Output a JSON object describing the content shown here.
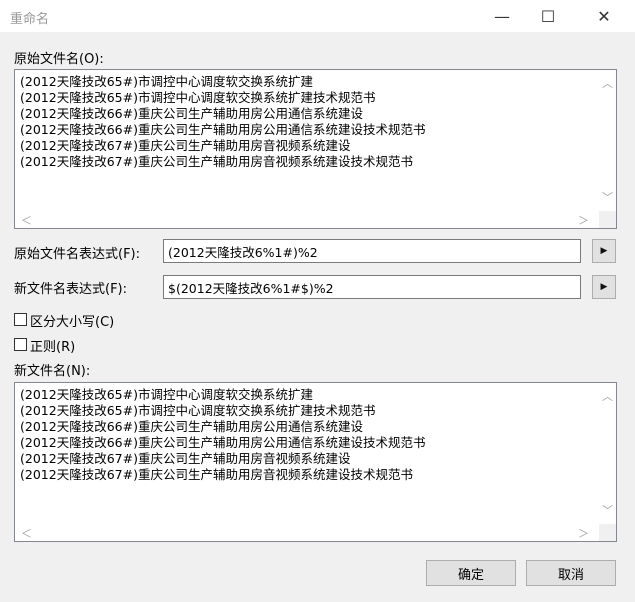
{
  "window": {
    "title": "重命名",
    "minimize_glyph": "—",
    "maximize_glyph": "☐",
    "close_glyph": "✕"
  },
  "original_names": {
    "label": "原始文件名(O):",
    "items": [
      "(2012天隆技改65#)市调控中心调度软交换系统扩建",
      "(2012天隆技改65#)市调控中心调度软交换系统扩建技术规范书",
      "(2012天隆技改66#)重庆公司生产辅助用房公用通信系统建设",
      "(2012天隆技改66#)重庆公司生产辅助用房公用通信系统建设技术规范书",
      "(2012天隆技改67#)重庆公司生产辅助用房音视频系统建设",
      "(2012天隆技改67#)重庆公司生产辅助用房音视频系统建设技术规范书"
    ]
  },
  "original_expression": {
    "label": "原始文件名表达式(F):",
    "value": "(2012天隆技改6%1#)%2"
  },
  "new_expression": {
    "label": "新文件名表达式(F):",
    "value": "$(2012天隆技改6%1#$)%2"
  },
  "options": {
    "case_sensitive": {
      "label": "区分大小写(C)",
      "checked": false
    },
    "regex": {
      "label": "正则(R)",
      "checked": false
    }
  },
  "new_names": {
    "label": "新文件名(N):",
    "items": [
      "(2012天隆技改65#)市调控中心调度软交换系统扩建",
      "(2012天隆技改65#)市调控中心调度软交换系统扩建技术规范书",
      "(2012天隆技改66#)重庆公司生产辅助用房公用通信系统建设",
      "(2012天隆技改66#)重庆公司生产辅助用房公用通信系统建设技术规范书",
      "(2012天隆技改67#)重庆公司生产辅助用房音视频系统建设",
      "(2012天隆技改67#)重庆公司生产辅助用房音视频系统建设技术规范书"
    ]
  },
  "buttons": {
    "ok": "确定",
    "cancel": "取消",
    "expand_glyph": "▶"
  },
  "scroll_glyphs": {
    "up": "︿",
    "down": "﹀",
    "left": "＜",
    "right": "＞"
  }
}
